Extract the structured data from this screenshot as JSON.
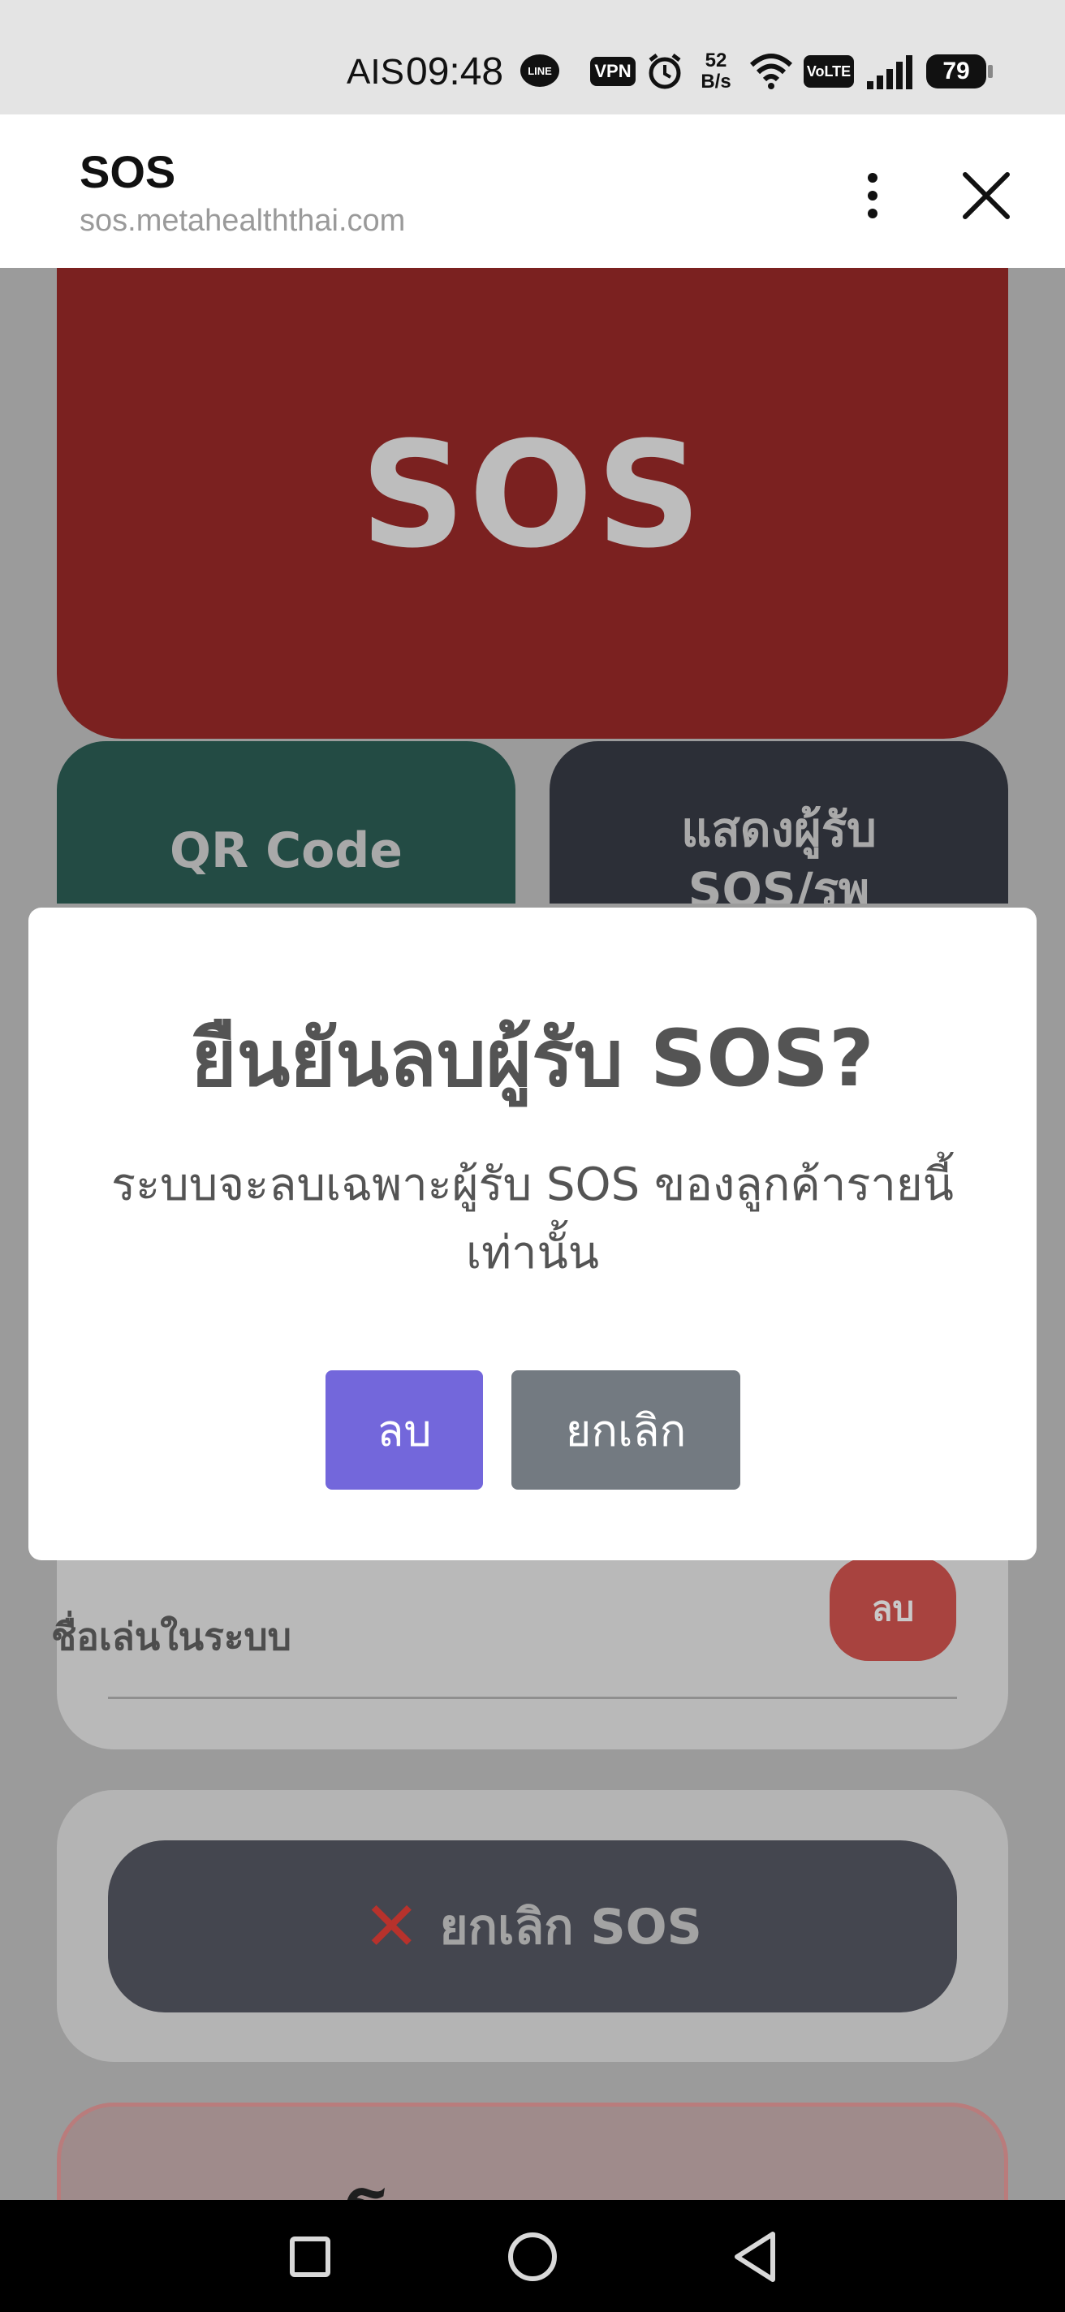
{
  "status_bar": {
    "carrier": "AIS",
    "time": "09:48",
    "speed_top": "52",
    "speed_bottom": "B/s",
    "vpn": "VPN",
    "volte": "VoLTE",
    "battery": "79",
    "icons": [
      "line-icon",
      "vpn-icon",
      "alarm-icon",
      "wifi-icon",
      "volte-icon",
      "signal-icon",
      "battery-icon"
    ]
  },
  "browser": {
    "title": "SOS",
    "url": "sos.metahealththai.com"
  },
  "page": {
    "sos_button": "SOS",
    "qr_tile": "QR Code",
    "show_tile": "แสดงผู้รับ SOS/รพ",
    "member_name": "ชื่อเล่นในระบบ",
    "member_delete": "ลบ",
    "cancel_sos": "ยกเลิก SOS",
    "bottom_title": "การโหลดแผน SOS"
  },
  "modal": {
    "title": "ยืนยันลบผู้รับ SOS?",
    "message": "ระบบจะลบเฉพาะผู้รับ SOS ของลูกค้ารายนี้เท่านั้น",
    "confirm": "ลบ",
    "cancel": "ยกเลิก"
  },
  "colors": {
    "sos_red": "#7b2120",
    "qr_green": "#234b44",
    "dark_tile": "#2c2f37",
    "confirm_purple": "#7367db",
    "cancel_gray": "#737a81"
  }
}
